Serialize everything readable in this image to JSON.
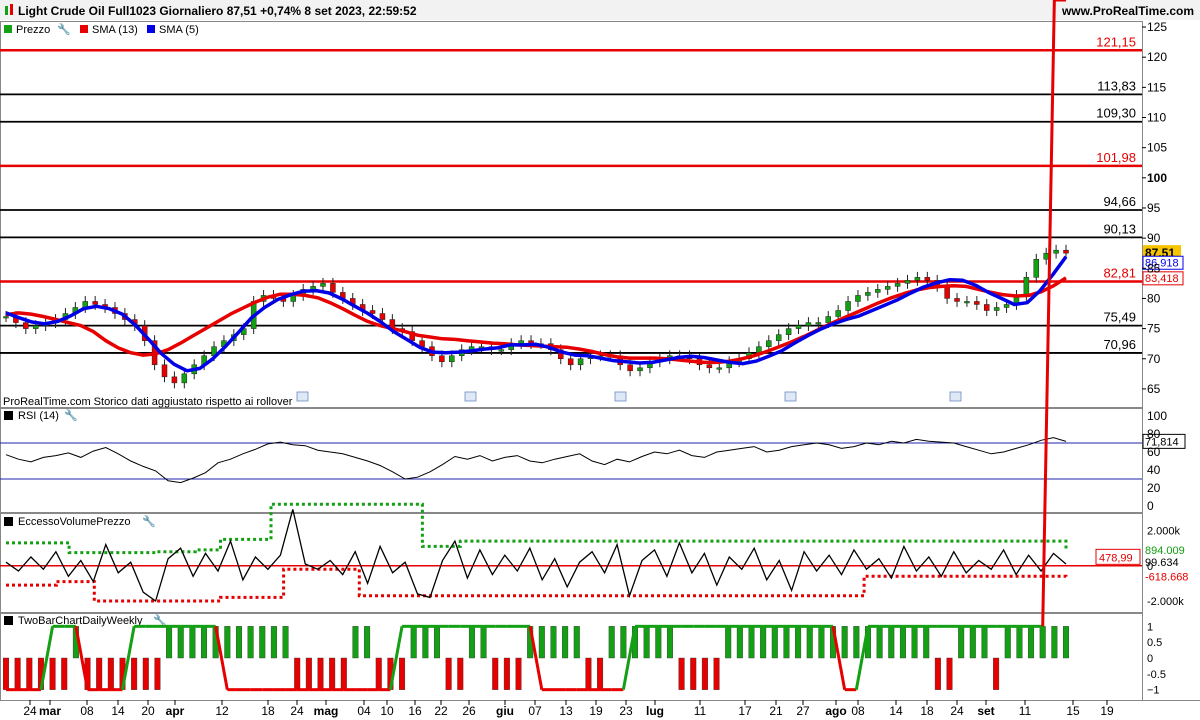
{
  "header": {
    "title": "Light Crude Oil Full1023 Giornaliero 87,51 +0,74% 8 set 2023, 22:59:52",
    "site": "www.ProRealTime.com"
  },
  "price_panel": {
    "legend": [
      "Prezzo",
      "SMA (13)",
      "SMA (5)"
    ],
    "note": "ProRealTime.com  Storico dati aggiustato rispetto ai rollover",
    "current_price_label": "87,51",
    "sma5_label": "86,918",
    "sma13_label": "83,418"
  },
  "rsi_panel": {
    "legend": "RSI (14)",
    "value_label": "71,814"
  },
  "volume_panel": {
    "legend": "EccessoVolumePrezzo",
    "upper_label": "894.009",
    "value_label": "99.634",
    "lower_label": "-618.668",
    "marker_label": "478,99"
  },
  "twobar_panel": {
    "legend": "TwoBarChartDailyWeekly"
  },
  "axes": {
    "price_ticks": [
      "125",
      "120",
      "115",
      "110",
      "105",
      "100",
      "95",
      "90",
      "85",
      "80",
      "75",
      "70",
      "65"
    ],
    "rsi_ticks": [
      "100",
      "80",
      "60",
      "40",
      "20",
      "0"
    ],
    "volume_ticks": [
      "2.000k",
      "0",
      "-2.000k"
    ],
    "twobar_ticks": [
      "1",
      "0.5",
      "0",
      "-0.5",
      "-1"
    ],
    "date_ticks": [
      "24",
      "mar",
      "08",
      "14",
      "20",
      "apr",
      "12",
      "18",
      "24",
      "mag",
      "04",
      "10",
      "16",
      "22",
      "26",
      "giu",
      "07",
      "13",
      "19",
      "23",
      "lug",
      "11",
      "17",
      "21",
      "27",
      "ago",
      "08",
      "14",
      "18",
      "24",
      "set",
      "11",
      "15",
      "19"
    ]
  },
  "colors": {
    "red": "#e60000",
    "blue": "#0000e6",
    "green": "#14a014",
    "black": "#000000",
    "grid": "#cccccc",
    "rsi_line": "#2222aa",
    "price_badge": "#f6c400"
  },
  "chart_data": [
    {
      "type": "line",
      "title": "Light Crude Oil Full1023 Giornaliero",
      "ylim": [
        62,
        126
      ],
      "horizontal_levels": [
        {
          "label": "121,15",
          "value": 121.15,
          "color": "red"
        },
        {
          "label": "113,83",
          "value": 113.83,
          "color": "black"
        },
        {
          "label": "109,30",
          "value": 109.3,
          "color": "black"
        },
        {
          "label": "101,98",
          "value": 101.98,
          "color": "red"
        },
        {
          "label": "94,66",
          "value": 94.66,
          "color": "black"
        },
        {
          "label": "90,13",
          "value": 90.13,
          "color": "black"
        },
        {
          "label": "82,81",
          "value": 82.81,
          "color": "red"
        },
        {
          "label": "75,49",
          "value": 75.49,
          "color": "black"
        },
        {
          "label": "70,96",
          "value": 70.96,
          "color": "black"
        }
      ],
      "price": [
        77,
        76,
        75,
        75.5,
        76,
        76.5,
        77.5,
        78.5,
        79.5,
        79,
        78.5,
        77.5,
        76.5,
        75.5,
        73,
        69,
        67,
        66,
        67.5,
        69,
        70.5,
        72,
        73,
        74,
        75,
        79.5,
        80.5,
        80,
        79.5,
        80.5,
        81.5,
        82,
        82.5,
        81,
        80,
        79,
        78,
        77.5,
        76.5,
        75,
        74.5,
        73,
        72,
        70.5,
        69.5,
        70.5,
        71.5,
        72,
        72,
        71.5,
        71.5,
        72.5,
        73,
        72.5,
        72.5,
        71.5,
        70,
        69,
        70,
        70.5,
        70.5,
        70.5,
        69,
        68,
        68.5,
        69.5,
        70,
        70.5,
        70.5,
        70,
        69,
        68.5,
        68.5,
        69.5,
        70,
        71,
        72,
        73,
        74,
        75,
        75.5,
        76,
        76,
        77,
        78,
        79.5,
        80.5,
        81,
        81.5,
        82,
        82.5,
        83,
        83.5,
        83,
        82,
        80,
        79.5,
        79.5,
        79,
        78,
        78.5,
        79,
        80.5,
        83.5,
        86.5,
        87.5,
        88,
        87.51
      ],
      "series": [
        {
          "name": "SMA (13)",
          "values": [
            77.3,
            77.6,
            77.4,
            77.0,
            76.5,
            76.0,
            75.5,
            74.5,
            73.0,
            71.8,
            71.0,
            70.6,
            70.8,
            71.5,
            72.6,
            73.8,
            75.0,
            76.2,
            77.4,
            78.4,
            79.4,
            80.2,
            80.7,
            80.7,
            80.5,
            80.1,
            79.3,
            78.3,
            77.2,
            76.2,
            75.5,
            75.0,
            74.5,
            73.9,
            73.6,
            73.3,
            73.2,
            73.0,
            72.8,
            72.6,
            72.5,
            72.3,
            72.2,
            72.1,
            72.0,
            71.9,
            71.6,
            71.2,
            70.7,
            70.3,
            70.1,
            70.1,
            70.1,
            70.0,
            69.8,
            69.6,
            69.4,
            69.4,
            69.6,
            70.0,
            70.5,
            71.2,
            72.0,
            72.8,
            73.7,
            74.7,
            75.7,
            76.6,
            77.5,
            78.4,
            79.3,
            80.1,
            80.8,
            81.4,
            81.8,
            82.0,
            82.1,
            82.0,
            81.5,
            81.0,
            80.6,
            80.4,
            80.5,
            81.1,
            82.1,
            83.418
          ]
        },
        {
          "name": "SMA (5)",
          "values": [
            77.6,
            76.8,
            76.1,
            75.8,
            76.2,
            77.1,
            78.3,
            78.7,
            78.3,
            77.4,
            75.6,
            73.3,
            70.9,
            69.1,
            68.0,
            68.4,
            70.0,
            72.1,
            74.4,
            76.8,
            78.5,
            79.8,
            80.6,
            81.2,
            81.3,
            80.9,
            79.9,
            78.7,
            77.5,
            76.1,
            74.5,
            73.2,
            71.9,
            71.1,
            71.0,
            71.1,
            71.3,
            71.6,
            71.8,
            72.3,
            72.3,
            72.4,
            71.9,
            71.1,
            70.6,
            70.5,
            70.1,
            69.7,
            69.5,
            69.3,
            69.4,
            69.8,
            70.2,
            70.4,
            70.2,
            69.8,
            69.4,
            69.2,
            69.6,
            70.4,
            71.3,
            72.6,
            73.8,
            74.9,
            75.8,
            76.5,
            77.1,
            78.0,
            78.9,
            79.8,
            80.9,
            81.9,
            82.6,
            83.1,
            83.0,
            82.2,
            81.0,
            80.0,
            79.0,
            79.3,
            81.3,
            84.0,
            86.918
          ]
        }
      ]
    },
    {
      "type": "line",
      "title": "RSI (14)",
      "ylim": [
        0,
        100
      ],
      "horizontal_levels": [
        70,
        30
      ],
      "values": [
        57,
        52,
        49,
        54,
        56,
        59,
        54,
        61,
        65,
        58,
        50,
        44,
        39,
        28,
        26,
        31,
        37,
        48,
        52,
        58,
        63,
        69,
        71,
        68,
        67,
        62,
        60,
        58,
        54,
        50,
        45,
        38,
        30,
        32,
        38,
        46,
        55,
        52,
        56,
        50,
        54,
        56,
        50,
        48,
        52,
        55,
        58,
        50,
        46,
        52,
        49,
        55,
        60,
        58,
        62,
        56,
        54,
        60,
        62,
        64,
        66,
        60,
        62,
        66,
        68,
        70,
        68,
        64,
        66,
        70,
        68,
        72,
        70,
        74,
        72,
        71,
        70,
        66,
        62,
        58,
        60,
        64,
        68,
        73,
        76,
        71.814
      ]
    },
    {
      "type": "line",
      "title": "EccessoVolumePrezzo",
      "ylim": [
        -2400,
        2600
      ],
      "values": [
        200,
        -300,
        500,
        -200,
        800,
        -600,
        300,
        -900,
        1200,
        -400,
        200,
        -1500,
        -2000,
        400,
        1000,
        -600,
        700,
        -300,
        1400,
        -800,
        500,
        -200,
        600,
        3200,
        100,
        -200,
        300,
        -500,
        800,
        -1000,
        1100,
        -400,
        200,
        -1600,
        -1800,
        300,
        1400,
        -700,
        900,
        -500,
        600,
        -300,
        1000,
        -800,
        400,
        -1200,
        200,
        800,
        -400,
        1200,
        -1700,
        300,
        900,
        -600,
        1300,
        -400,
        700,
        -1100,
        500,
        -200,
        1000,
        -800,
        300,
        -1400,
        800,
        -300,
        600,
        -500,
        900,
        -200,
        400,
        -700,
        1100,
        -300,
        500,
        -600,
        800,
        -400,
        300,
        -200,
        900,
        -500,
        600,
        -300,
        700,
        99.634
      ],
      "upper_band": [
        1300,
        1300,
        1300,
        1300,
        1300,
        750,
        750,
        750,
        750,
        750,
        750,
        750,
        800,
        800,
        800,
        900,
        900,
        1500,
        1500,
        1500,
        1500,
        3500,
        3500,
        3500,
        3500,
        3500,
        3500,
        3500,
        3500,
        3500,
        3500,
        3500,
        3500,
        1100,
        1100,
        1100,
        1400,
        1400,
        1400,
        1400,
        1400,
        1400,
        1400,
        1400,
        1400,
        1400,
        1400,
        1400,
        1400,
        1400,
        1400,
        1400,
        1400,
        1400,
        1400,
        1400,
        1400,
        1400,
        1400,
        1400,
        1400,
        1400,
        1400,
        1400,
        1400,
        1400,
        1400,
        1400,
        1400,
        1400,
        1400,
        1400,
        1400,
        1400,
        1400,
        1400,
        1400,
        1400,
        1400,
        1400,
        1400,
        1400,
        1400,
        1400,
        894.009
      ],
      "lower_band": [
        -1100,
        -1100,
        -1100,
        -1100,
        -900,
        -900,
        -900,
        -2000,
        -2000,
        -2000,
        -2000,
        -2000,
        -2000,
        -2000,
        -2000,
        -2000,
        -2000,
        -1800,
        -1800,
        -1800,
        -1800,
        -1800,
        -200,
        -200,
        -200,
        -200,
        -200,
        -200,
        -1700,
        -1700,
        -1700,
        -1700,
        -1700,
        -1700,
        -1700,
        -1700,
        -1700,
        -1700,
        -1700,
        -1700,
        -1700,
        -1700,
        -1700,
        -1700,
        -1700,
        -1700,
        -1700,
        -1700,
        -1700,
        -1700,
        -1700,
        -1700,
        -1700,
        -1700,
        -1700,
        -1700,
        -1700,
        -1700,
        -1700,
        -1700,
        -1700,
        -1700,
        -1700,
        -1700,
        -1700,
        -1700,
        -1700,
        -1700,
        -600,
        -600,
        -600,
        -600,
        -600,
        -600,
        -600,
        -600,
        -600,
        -600,
        -600,
        -600,
        -600,
        -600,
        -600,
        -600,
        -618.668
      ],
      "marker_level": 478.99
    },
    {
      "type": "bar",
      "title": "TwoBarChartDailyWeekly",
      "ylim": [
        -1.2,
        1.2
      ],
      "daily_values": [
        -1,
        -1,
        -1,
        -1,
        -1,
        -1,
        1,
        -1,
        -1,
        -1,
        -1,
        -1,
        -1,
        -1,
        1,
        1,
        1,
        1,
        1,
        1,
        1,
        1,
        1,
        1,
        1,
        -1,
        -1,
        -1,
        -1,
        -1,
        1,
        1,
        -1,
        -1,
        -1,
        1,
        1,
        1,
        -1,
        -1,
        1,
        1,
        -1,
        -1,
        -1,
        1,
        1,
        1,
        1,
        1,
        -1,
        -1,
        1,
        1,
        1,
        1,
        1,
        1,
        -1,
        -1,
        -1,
        -1,
        1,
        1,
        1,
        1,
        1,
        1,
        1,
        1,
        1,
        1,
        1,
        1,
        1,
        1,
        1,
        1,
        1,
        1,
        -1,
        -1,
        1,
        1,
        1,
        -1,
        1,
        1,
        1,
        1,
        1,
        1
      ],
      "weekly_values": [
        -1,
        -1,
        -1,
        -1,
        1,
        1,
        1,
        -1,
        -1,
        -1,
        -1,
        1,
        1,
        1,
        1,
        1,
        1,
        1,
        1,
        -1,
        -1,
        -1,
        -1,
        -1,
        -1,
        -1,
        -1,
        -1,
        -1,
        -1,
        -1,
        -1,
        -1,
        -1,
        1,
        1,
        1,
        1,
        1,
        1,
        1,
        1,
        1,
        1,
        1,
        1,
        -1,
        -1,
        -1,
        -1,
        -1,
        -1,
        -1,
        -1,
        1,
        1,
        1,
        1,
        1,
        1,
        1,
        1,
        1,
        1,
        1,
        1,
        1,
        1,
        1,
        1,
        1,
        1,
        -1,
        -1,
        1,
        1,
        1,
        1,
        1,
        1,
        1,
        1,
        1,
        1,
        1,
        1,
        1,
        1,
        1,
        1
      ]
    }
  ]
}
